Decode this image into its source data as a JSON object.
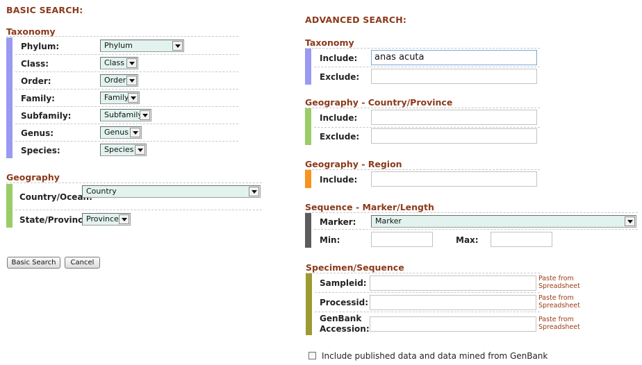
{
  "basic": {
    "heading": "BASIC SEARCH:",
    "taxonomy": {
      "title": "Taxonomy",
      "bar_color": "#9a9af2",
      "rows": [
        {
          "label": "Phylum:",
          "value": "Phylum"
        },
        {
          "label": "Class:",
          "value": "Class"
        },
        {
          "label": "Order:",
          "value": "Order"
        },
        {
          "label": "Family:",
          "value": "Family"
        },
        {
          "label": "Subfamily:",
          "value": "Subfamily"
        },
        {
          "label": "Genus:",
          "value": "Genus"
        },
        {
          "label": "Species:",
          "value": "Species"
        }
      ]
    },
    "geography": {
      "title": "Geography",
      "bar_color": "#9acd68",
      "country_label": "Country/Ocean:",
      "country_value": "Country",
      "state_label": "State/Province:",
      "state_value": "Province"
    },
    "buttons": {
      "search": "Basic Search",
      "cancel": "Cancel"
    }
  },
  "advanced": {
    "heading": "ADVANCED SEARCH:",
    "taxonomy": {
      "title": "Taxonomy",
      "bar_color": "#9a9af2",
      "include_label": "Include:",
      "include_value": "anas acuta",
      "exclude_label": "Exclude:",
      "exclude_value": ""
    },
    "geo_country": {
      "title": "Geography - Country/Province",
      "bar_color": "#9acd68",
      "include_label": "Include:",
      "exclude_label": "Exclude:"
    },
    "geo_region": {
      "title": "Geography - Region",
      "bar_color": "#f7931e",
      "include_label": "Include:"
    },
    "sequence": {
      "title": "Sequence - Marker/Length",
      "bar_color": "#5c5c5c",
      "marker_label": "Marker:",
      "marker_value": "Marker",
      "min_label": "Min:",
      "max_label": "Max:"
    },
    "specimen": {
      "title": "Specimen/Sequence",
      "bar_color": "#9c9a32",
      "sampleid_label": "Sampleid:",
      "processid_label": "Processid:",
      "genbank_label_line1": "GenBank",
      "genbank_label_line2": "Accession:",
      "paste_line1": "Paste from",
      "paste_line2": "Spreadsheet"
    },
    "include_published_label": "Include published data and data mined from GenBank"
  }
}
